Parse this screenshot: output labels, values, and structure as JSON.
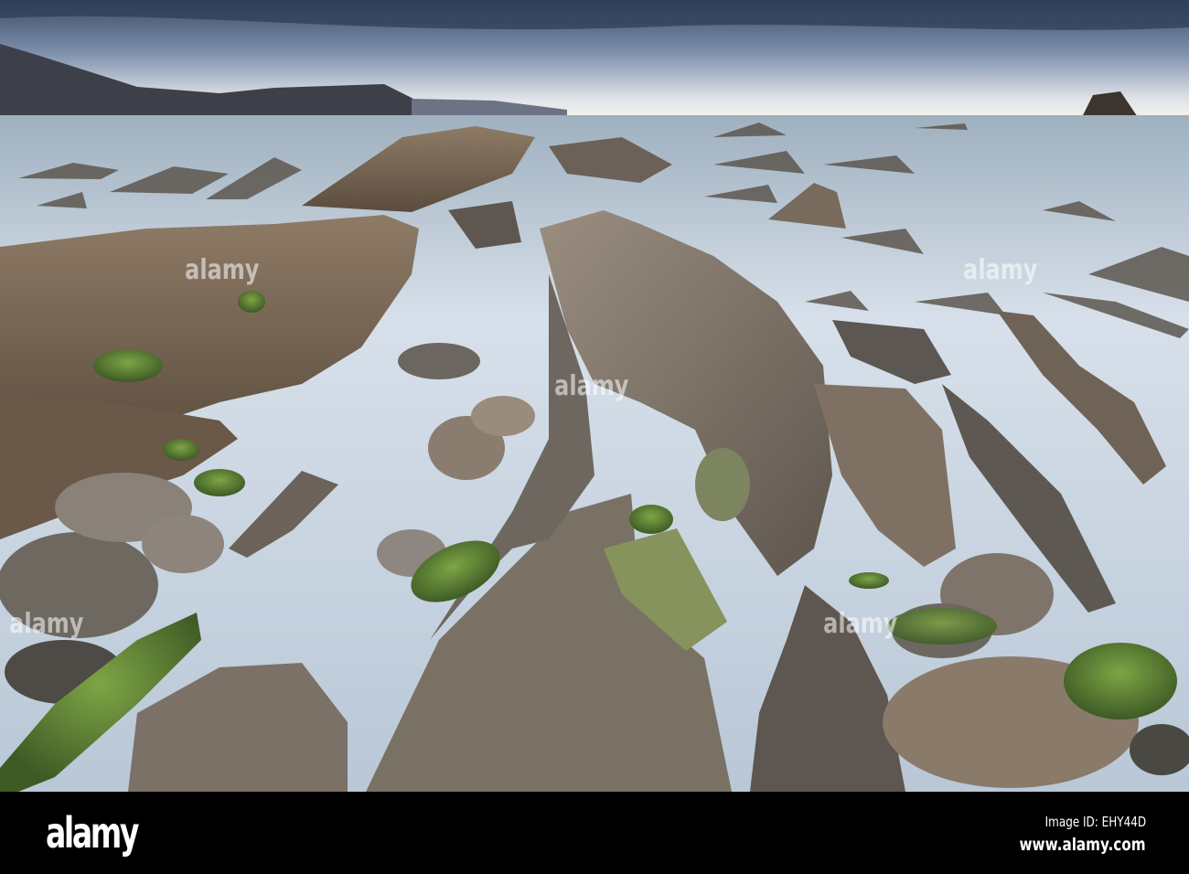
{
  "photo": {
    "subject": "coastal-rocks-long-exposure"
  },
  "watermark": {
    "text": "alamy"
  },
  "footer": {
    "logo": "alamy",
    "image_id": "Image ID: EHY44D",
    "url": "www.alamy.com"
  }
}
